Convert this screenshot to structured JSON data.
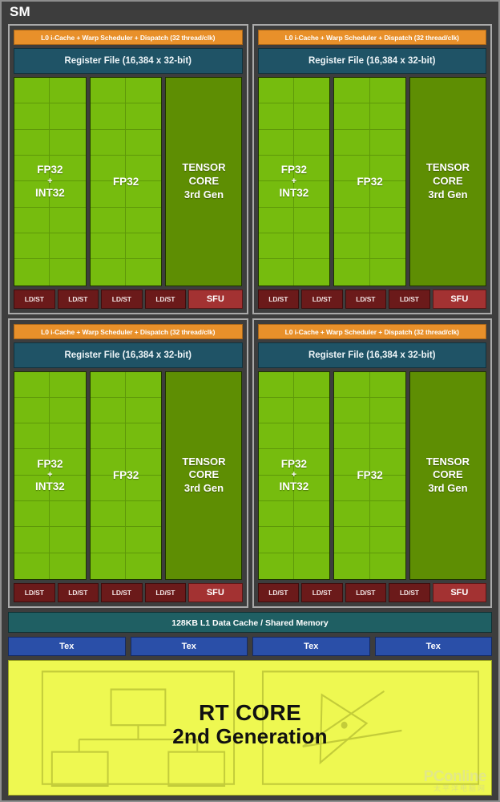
{
  "diagram": {
    "title": "SM",
    "subtitle_none": ""
  },
  "processing_block": {
    "scheduler_label": "L0 i-Cache + Warp Scheduler + Dispatch (32 thread/clk)",
    "register_file_label": "Register File (16,384 x 32-bit)",
    "cores": [
      {
        "name": "fp32-int32-core",
        "line1": "FP32",
        "plus": "+",
        "line2": "INT32"
      },
      {
        "name": "fp32-core",
        "line1": "FP32",
        "plus": "",
        "line2": ""
      }
    ],
    "tensor_core": {
      "line1": "TENSOR",
      "line2": "CORE",
      "line3": "3rd Gen"
    },
    "ldst_label": "LD/ST",
    "ldst_count": 4,
    "sfu_label": "SFU",
    "grid_columns": 2,
    "grid_rows": 8
  },
  "blocks_count": 4,
  "l1_cache": {
    "label": "128KB L1 Data Cache / Shared Memory"
  },
  "texture_units": {
    "label": "Tex",
    "count": 4
  },
  "rt_core": {
    "line1": "RT CORE",
    "line2": "2nd Generation",
    "left_diagram": "bvh-tree-icon",
    "right_diagram": "ray-triangle-intersection-icon"
  },
  "watermark": {
    "brand": "PConline",
    "subtitle": "太平洋电脑网"
  },
  "colors": {
    "background": "#3d3d3d",
    "frame_border": "#8e8e8e",
    "scheduler_orange": "#e8902a",
    "register_file_teal": "#1f5366",
    "fp32_green": "#76bc0e",
    "tensor_green": "#5e8e03",
    "ldst_red": "#6b1a1a",
    "sfu_red": "#a33232",
    "l1_teal": "#1f5f63",
    "tex_blue": "#2a4fa8",
    "rt_core_yellow": "#eef851"
  }
}
